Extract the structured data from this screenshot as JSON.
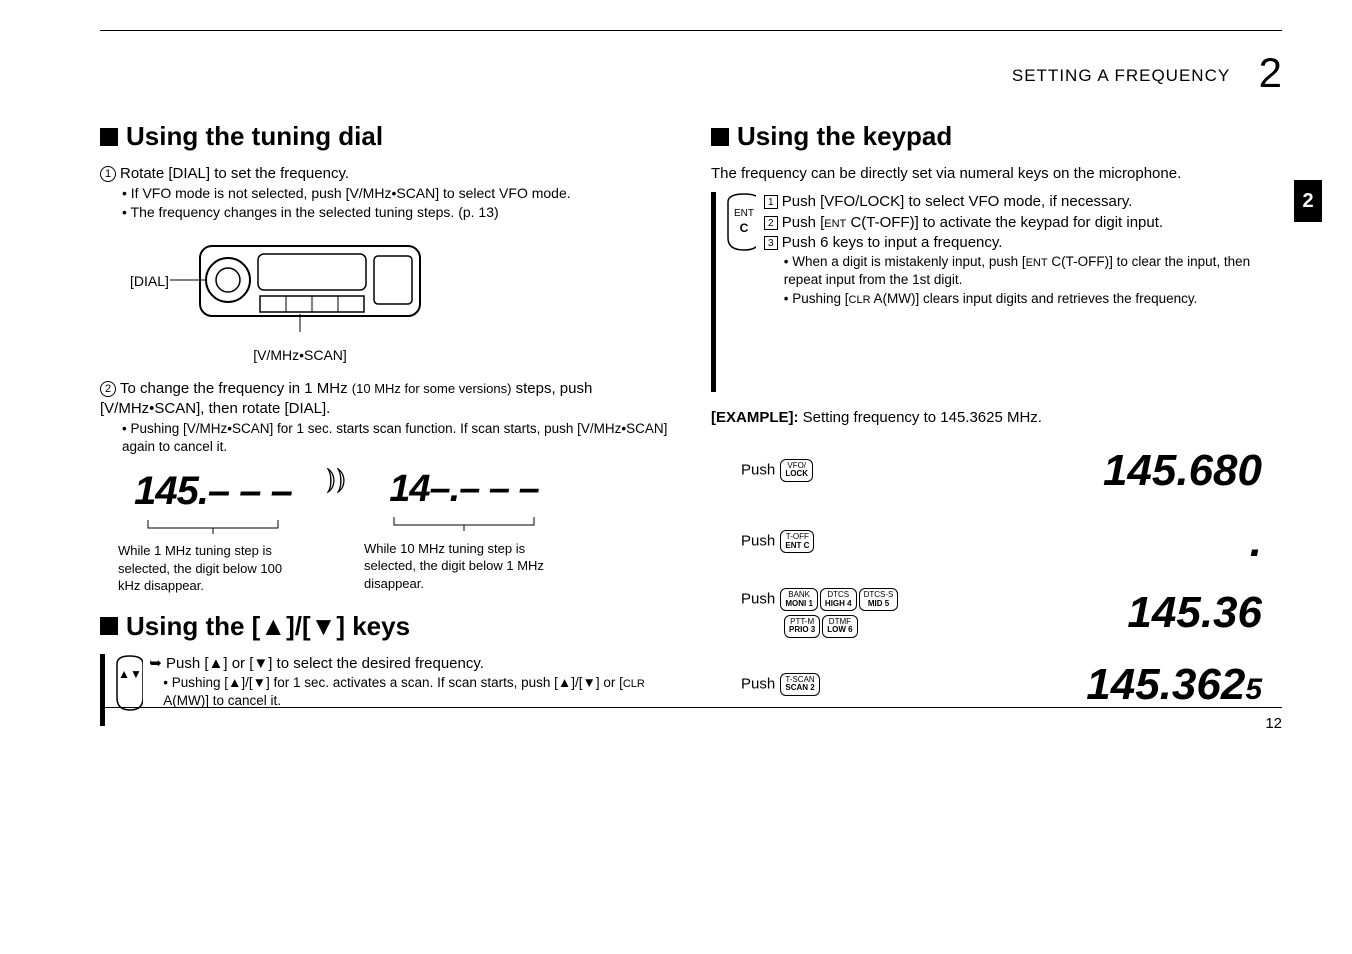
{
  "header": {
    "section_label": "SETTING A FREQUENCY",
    "chapter_number": "2",
    "tab_number": "2",
    "page_number": "12"
  },
  "left": {
    "h_tuning": "Using the tuning dial",
    "step1": "Rotate [DIAL] to set the frequency.",
    "step1_b1": "• If VFO mode is not selected, push [V/MHz•SCAN] to select VFO mode.",
    "step1_b2": "• The frequency changes in the selected tuning steps. (p. 13)",
    "dial_label": "[DIAL]",
    "vmhz_label": "[V/MHz•SCAN]",
    "step2_a": "To change the frequency in 1 MHz ",
    "step2_paren": "(10 MHz for some versions)",
    "step2_b": " steps, push [V/MHz•SCAN], then rotate [DIAL].",
    "step2_sub": "• Pushing [V/MHz•SCAN] for 1 sec. starts scan function. If scan starts, push [V/MHz•SCAN] again to cancel it.",
    "seg_1mhz": "145.– – –",
    "seg_10mhz": "14–.– – –",
    "cap_1mhz": "While 1 MHz tuning step is selected, the digit below 100 kHz disappear.",
    "cap_10mhz": "While 10 MHz tuning step is selected, the digit below 1 MHz disappear.",
    "h_updown": "Using the [▲]/[▼] keys",
    "updown_main": "Push [▲] or [▼] to select the desired frequency.",
    "updown_sub_a": "• Pushing [▲]/[▼] for 1 sec. activates a scan. If scan starts, push [▲]/[▼] or [",
    "updown_sub_clr": "CLR",
    "updown_sub_b": " A(MW)] to cancel it."
  },
  "right": {
    "h_keypad": "Using the keypad",
    "intro": "The frequency can be directly set via numeral keys on the microphone.",
    "ent_label_top": "ENT",
    "ent_label_bot": "C",
    "b1": "Push [VFO/LOCK] to select VFO mode, if necessary.",
    "b2_a": "Push [",
    "b2_ent": "ENT",
    "b2_b": " C(T-OFF)] to activate the keypad for digit input.",
    "b3": "Push 6 keys to input a frequency.",
    "b3_s1_a": "• When a digit is mistakenly input, push [",
    "b3_s1_ent": "ENT",
    "b3_s1_b": " C(T-OFF)] to clear the input, then repeat input from the 1st digit.",
    "b3_s2_a": "• Pushing [",
    "b3_s2_clr": "CLR",
    "b3_s2_b": " A(MW)] clears input digits and retrieves the frequency.",
    "example_label": "[EXAMPLE]:",
    "example_text": " Setting frequency to 145.3625 MHz.",
    "rows": [
      {
        "push": "Push ",
        "keys": [
          {
            "t": "VFO/",
            "b": "LOCK"
          }
        ],
        "display": "145.680"
      },
      {
        "push": "Push ",
        "keys": [
          {
            "t": "T-OFF",
            "b": "ENT C"
          }
        ],
        "display": "."
      },
      {
        "push": "Push ",
        "keys": [
          {
            "t": "BANK",
            "b": "MONI 1"
          },
          {
            "t": "DTCS",
            "b": "HIGH 4"
          },
          {
            "t": "DTCS-S",
            "b": "MID 5"
          },
          {
            "t": "PTT-M",
            "b": "PRIO 3"
          },
          {
            "t": "DTMF",
            "b": "LOW 6"
          }
        ],
        "display": "145.36"
      },
      {
        "push": "Push ",
        "keys": [
          {
            "t": "T-SCAN",
            "b": "SCAN 2"
          }
        ],
        "display": "145.3625"
      }
    ]
  }
}
